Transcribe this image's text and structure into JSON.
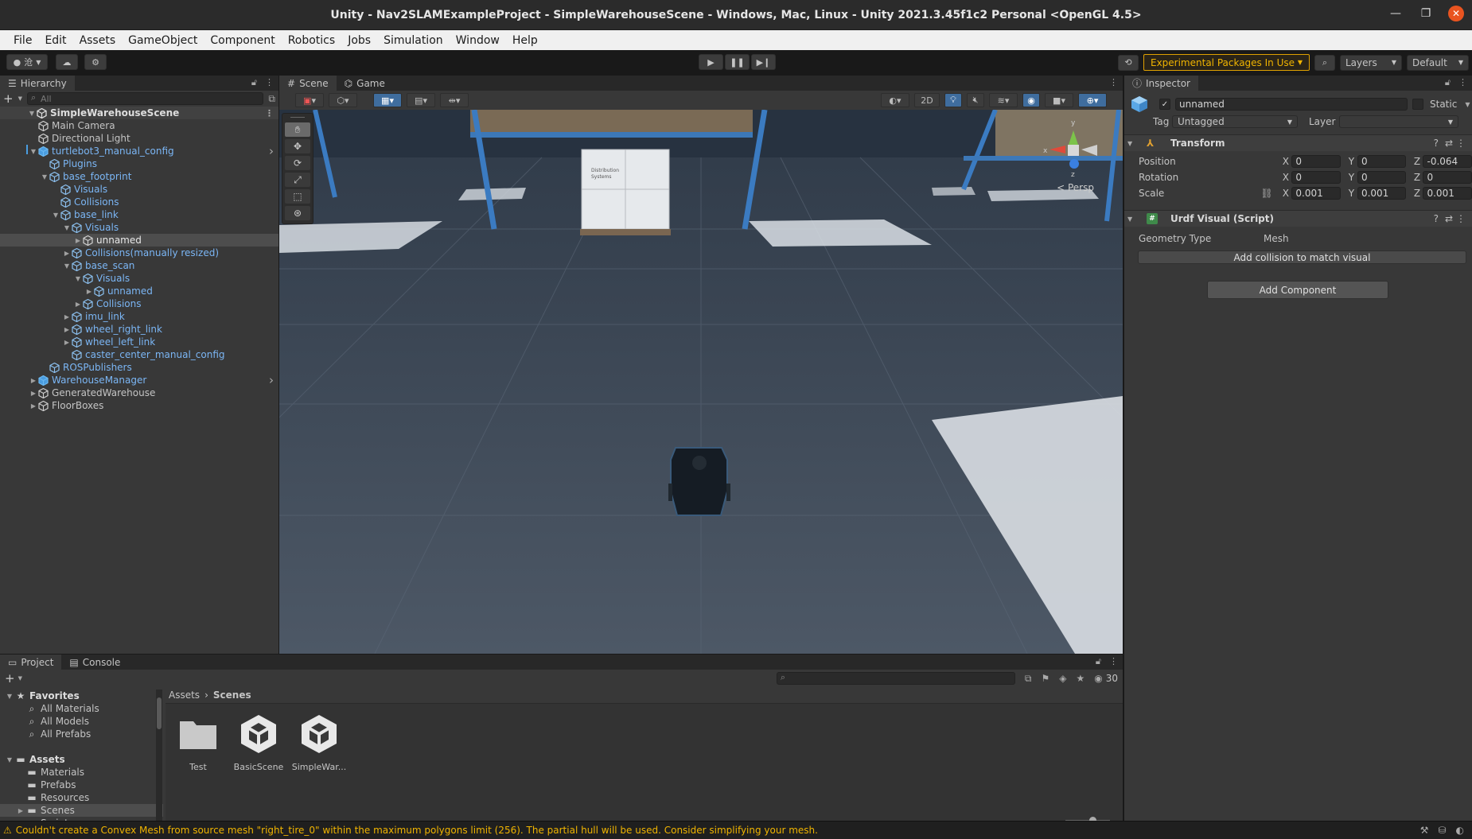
{
  "window": {
    "title": "Unity - Nav2SLAMExampleProject - SimpleWarehouseScene - Windows, Mac, Linux - Unity 2021.3.45f1c2 Personal <OpenGL 4.5>"
  },
  "menu": [
    "File",
    "Edit",
    "Assets",
    "GameObject",
    "Component",
    "Robotics",
    "Jobs",
    "Simulation",
    "Window",
    "Help"
  ],
  "toolbar": {
    "account_label": "沧",
    "experimental_badge": "Experimental Packages In Use",
    "layers": "Layers",
    "layout": "Default"
  },
  "hierarchy": {
    "tab": "Hierarchy",
    "search_placeholder": "All",
    "scene": "SimpleWarehouseScene",
    "rows": [
      {
        "name": "Main Camera",
        "level": 1,
        "caret": "",
        "color": "normal"
      },
      {
        "name": "Directional Light",
        "level": 1,
        "caret": "",
        "color": "normal"
      },
      {
        "name": "turtlebot3_manual_config",
        "level": 1,
        "caret": "open",
        "color": "blue",
        "prefab": true
      },
      {
        "name": "Plugins",
        "level": 2,
        "caret": "",
        "color": "blue"
      },
      {
        "name": "base_footprint",
        "level": 2,
        "caret": "open",
        "color": "blue"
      },
      {
        "name": "Visuals",
        "level": 3,
        "caret": "",
        "color": "blue"
      },
      {
        "name": "Collisions",
        "level": 3,
        "caret": "",
        "color": "blue"
      },
      {
        "name": "base_link",
        "level": 3,
        "caret": "open",
        "color": "blue"
      },
      {
        "name": "Visuals",
        "level": 4,
        "caret": "open",
        "color": "blue"
      },
      {
        "name": "unnamed",
        "level": 5,
        "caret": "closed",
        "color": "white",
        "selected": true
      },
      {
        "name": "Collisions(manually resized)",
        "level": 4,
        "caret": "closed",
        "color": "blue"
      },
      {
        "name": "base_scan",
        "level": 4,
        "caret": "open",
        "color": "blue"
      },
      {
        "name": "Visuals",
        "level": 5,
        "caret": "open",
        "color": "blue"
      },
      {
        "name": "unnamed",
        "level": 6,
        "caret": "closed",
        "color": "blue"
      },
      {
        "name": "Collisions",
        "level": 5,
        "caret": "closed",
        "color": "blue"
      },
      {
        "name": "imu_link",
        "level": 4,
        "caret": "closed",
        "color": "blue"
      },
      {
        "name": "wheel_right_link",
        "level": 4,
        "caret": "closed",
        "color": "blue"
      },
      {
        "name": "wheel_left_link",
        "level": 4,
        "caret": "closed",
        "color": "blue"
      },
      {
        "name": "caster_center_manual_config",
        "level": 4,
        "caret": "",
        "color": "blue"
      },
      {
        "name": "ROSPublishers",
        "level": 2,
        "caret": "",
        "color": "blue"
      },
      {
        "name": "WarehouseManager",
        "level": 1,
        "caret": "closed",
        "color": "blue",
        "prefab": true
      },
      {
        "name": "GeneratedWarehouse",
        "level": 1,
        "caret": "closed",
        "color": "normal"
      },
      {
        "name": "FloorBoxes",
        "level": 1,
        "caret": "closed",
        "color": "normal"
      }
    ]
  },
  "scene_view": {
    "tabs": [
      "Scene",
      "Game"
    ],
    "mode_2d": "2D",
    "persp": "< Persp",
    "box_label": [
      "Distribution",
      "Systems"
    ]
  },
  "inspector": {
    "tab": "Inspector",
    "object_name": "unnamed",
    "static_label": "Static",
    "tag_label": "Tag",
    "tag_value": "Untagged",
    "layer_label": "Layer",
    "layer_value": "",
    "transform": {
      "title": "Transform",
      "position_label": "Position",
      "rotation_label": "Rotation",
      "scale_label": "Scale",
      "position": {
        "x": "0",
        "y": "0",
        "z": "-0.064"
      },
      "rotation": {
        "x": "0",
        "y": "0",
        "z": "0"
      },
      "scale": {
        "x": "0.001",
        "y": "0.001",
        "z": "0.001"
      }
    },
    "urdf": {
      "title": "Urdf Visual (Script)",
      "geometry_label": "Geometry Type",
      "geometry_value": "Mesh",
      "match_button": "Add collision to match visual"
    },
    "add_component": "Add Component"
  },
  "project": {
    "tabs": [
      "Project",
      "Console"
    ],
    "tree": [
      {
        "name": "Favorites",
        "bold": true,
        "caret": "open",
        "icon": "star",
        "level": 0
      },
      {
        "name": "All Materials",
        "icon": "search",
        "level": 1
      },
      {
        "name": "All Models",
        "icon": "search",
        "level": 1
      },
      {
        "name": "All Prefabs",
        "icon": "search",
        "level": 1
      },
      {
        "name": "",
        "icon": "",
        "level": 0
      },
      {
        "name": "Assets",
        "bold": true,
        "caret": "open",
        "icon": "folder",
        "level": 0
      },
      {
        "name": "Materials",
        "icon": "folder",
        "level": 1
      },
      {
        "name": "Prefabs",
        "icon": "folder",
        "level": 1
      },
      {
        "name": "Resources",
        "icon": "folder",
        "level": 1
      },
      {
        "name": "Scenes",
        "icon": "folder",
        "level": 1,
        "caret": "closed",
        "selected": true
      },
      {
        "name": "Scripts",
        "icon": "folder",
        "level": 1,
        "caret": "closed"
      }
    ],
    "breadcrumb": [
      "Assets",
      "Scenes"
    ],
    "item_count": "30",
    "assets": [
      {
        "name": "Test",
        "type": "folder"
      },
      {
        "name": "BasicScene",
        "type": "unity"
      },
      {
        "name": "SimpleWar...",
        "type": "unity"
      }
    ]
  },
  "status": {
    "message": "Couldn't create a Convex Mesh from source mesh \"right_tire_0\" within the maximum polygons limit (256). The partial hull will be used. Consider simplifying your mesh."
  }
}
